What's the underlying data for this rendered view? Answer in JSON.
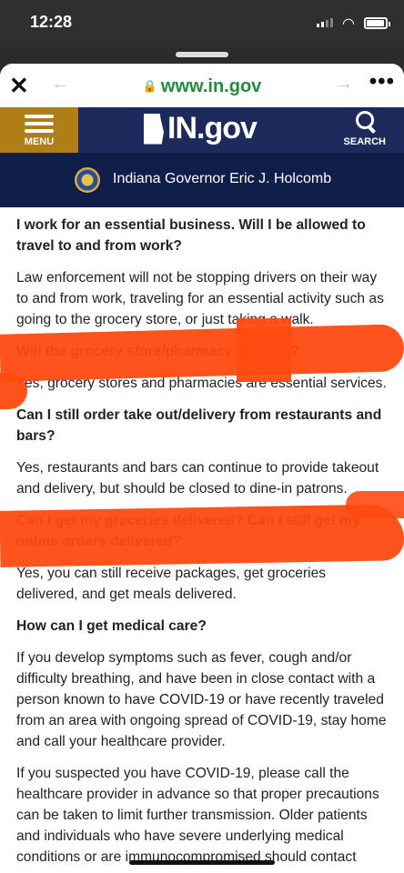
{
  "status_bar": {
    "time": "12:28"
  },
  "browser": {
    "url": "www.in.gov",
    "close_glyph": "✕",
    "back_glyph": "←",
    "forward_glyph": "→",
    "more_glyph": "•••"
  },
  "site_header": {
    "menu_label": "MENU",
    "logo_text": "IN.gov",
    "search_label": "SEARCH"
  },
  "agency_bar": {
    "title": "Indiana Governor Eric J. Holcomb"
  },
  "faq": [
    {
      "q": "I work for an essential business. Will I be allowed to travel to and from work?",
      "a": "Law enforcement will not be stopping drivers on their way to and from work, traveling for an essential activity such as going to the grocery store, or just taking a walk."
    },
    {
      "q": "Will the grocery store/pharmacy be open?",
      "a": "Yes, grocery stores and pharmacies are essential services."
    },
    {
      "q": "Can I still order take out/delivery from restaurants and bars?",
      "a": "Yes, restaurants and bars can continue to provide takeout and delivery, but should be closed to dine-in patrons."
    },
    {
      "q": "Can I get my groceries delivered? Can I still get my online orders delivered?",
      "a": "Yes, you can still receive packages, get groceries delivered, and get meals delivered."
    },
    {
      "q": "How can I get medical care?",
      "a": "If you develop symptoms such as fever, cough and/or difficulty breathing, and have been in close contact with a person known to have COVID-19 or have recently traveled from an area with ongoing spread of COVID-19, stay home and call your healthcare provider.",
      "a2": "If you suspected you have COVID-19, please call the healthcare provider in advance so that proper precautions can be taken to limit further transmission. Older patients and individuals who have severe underlying medical conditions or are immunocompromised should contact"
    }
  ],
  "colors": {
    "header_navy": "#1c2a5c",
    "menu_gold": "#b07e16",
    "url_green": "#1e8e3e",
    "scribble_orange": "#ff4a12"
  }
}
